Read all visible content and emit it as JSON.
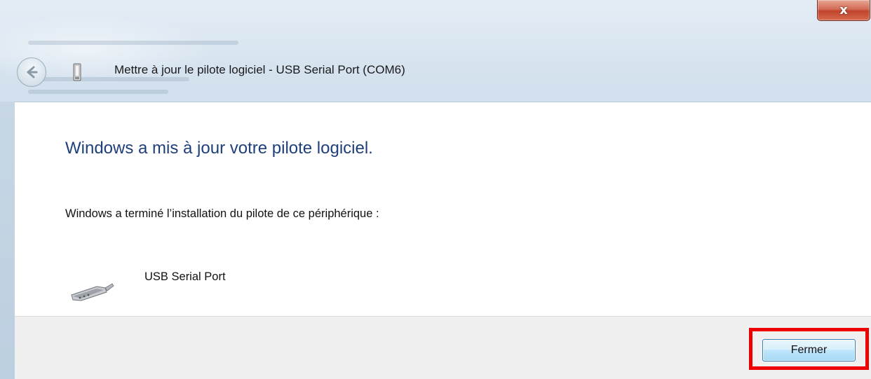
{
  "window": {
    "title": "Mettre à jour le pilote logiciel - USB Serial Port (COM6)",
    "close_symbol": "x",
    "back_icon": "back-arrow-icon",
    "device_icon": "usb-device-icon"
  },
  "main": {
    "heading": "Windows a mis à jour votre pilote logiciel.",
    "message": "Windows a terminé l’installation du pilote de ce périphérique :",
    "device_name": "USB Serial Port",
    "device_icon": "usb-connector-icon"
  },
  "footer": {
    "close_label": "Fermer",
    "highlight_color": "#ee0000"
  },
  "colors": {
    "heading": "#1e3f7a",
    "close_button": "#c1432b",
    "button_border": "#3c7fb1"
  }
}
